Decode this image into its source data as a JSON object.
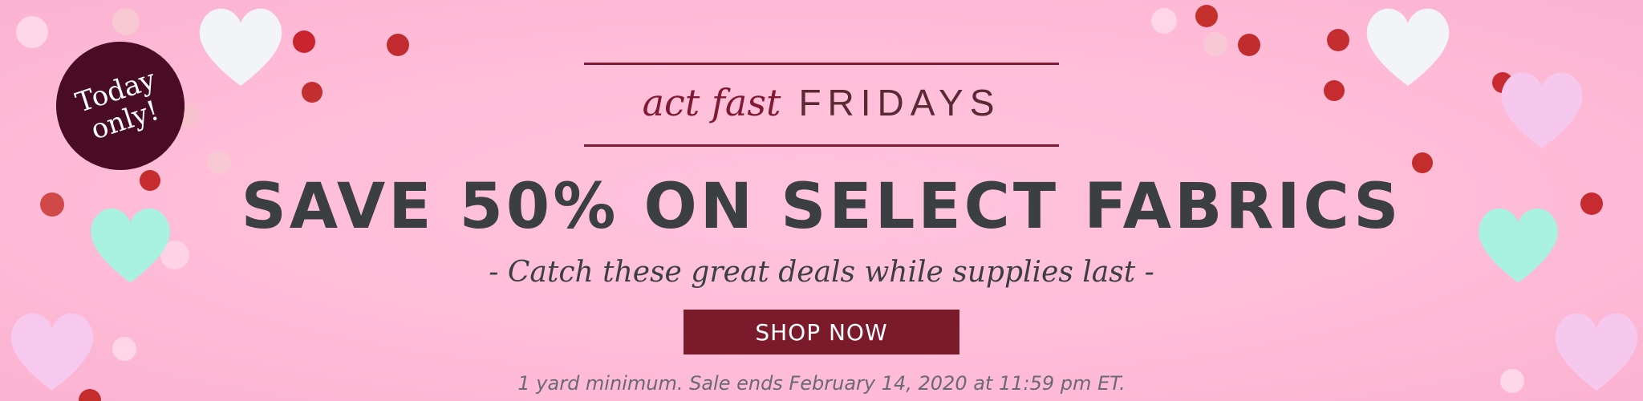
{
  "badge": {
    "line1": "Today",
    "line2": "only!"
  },
  "promo": {
    "script_text": "act fast",
    "fridays_text": "FRIDAYS",
    "headline": "SAVE 50% ON SELECT FABRICS",
    "tagline": "- Catch these great deals while supplies last -",
    "button_label": "SHOP NOW",
    "fine_print": "1 yard minimum. Sale ends February 14, 2020 at 11:59 pm ET."
  },
  "colors": {
    "background": "#ffbdd8",
    "badge": "#4a0b25",
    "accent": "#7b1a2a",
    "text_dark": "#3b3f42"
  }
}
